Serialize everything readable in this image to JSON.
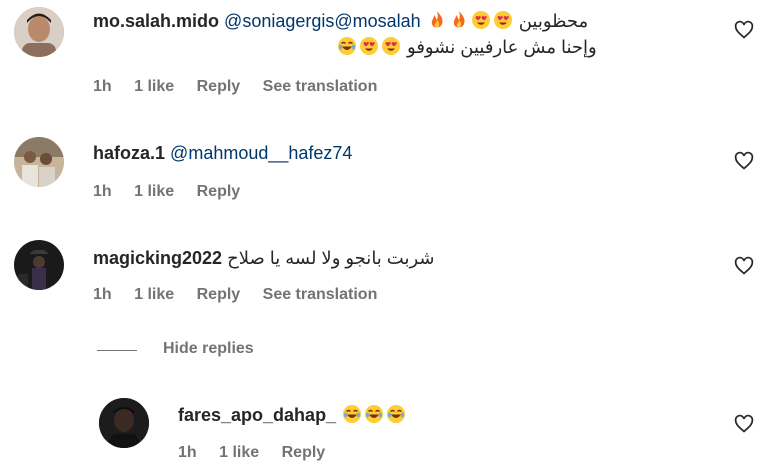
{
  "comments": [
    {
      "username": "mo.salah.mido",
      "mentions": "@soniagergis@mosalah",
      "text_line1_ar": "محظوبين",
      "text_line2_ar": "وإحنا مش عارفيين نشوفو",
      "time": "1h",
      "likes": "1 like",
      "reply": "Reply",
      "translation": "See translation"
    },
    {
      "username": "hafoza.1",
      "mentions": "@mahmoud__hafez74",
      "time": "1h",
      "likes": "1 like",
      "reply": "Reply"
    },
    {
      "username": "magicking2022",
      "text_ar": "شربت بانجو ولا لسه يا صلاح",
      "time": "1h",
      "likes": "1 like",
      "reply": "Reply",
      "translation": "See translation"
    }
  ],
  "hide_replies": "Hide replies",
  "reply": {
    "username": "fares_apo_dahap_",
    "time": "1h",
    "likes": "1 like",
    "reply": "Reply"
  },
  "icons": {
    "heart": "heart-outline-icon",
    "fire": "fire-emoji",
    "heart_eyes": "heart-eyes-emoji",
    "laughing": "face-with-tears-of-joy-emoji"
  }
}
